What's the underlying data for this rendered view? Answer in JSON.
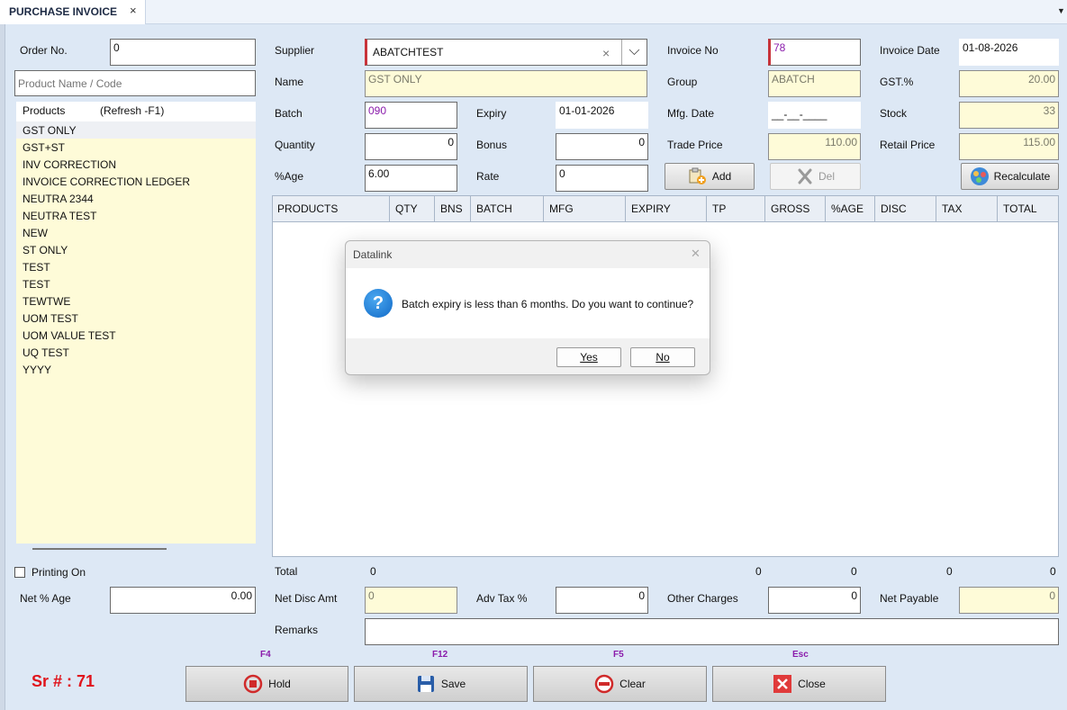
{
  "tab": {
    "title": "PURCHASE INVOICE",
    "close": "×",
    "menu": "▼"
  },
  "order": {
    "label": "Order No.",
    "value": "0"
  },
  "search": {
    "placeholder": "Product Name / Code"
  },
  "products": {
    "header": "Products",
    "refresh": "(Refresh -F1)",
    "items": [
      "GST ONLY",
      "GST+ST",
      "INV CORRECTION",
      "INVOICE CORRECTION LEDGER",
      "NEUTRA 2344",
      "NEUTRA TEST",
      "NEW",
      "ST ONLY",
      "TEST",
      "TEST",
      "TEWTWE",
      "UOM TEST",
      "UOM VALUE TEST",
      "UQ TEST",
      "YYYY"
    ]
  },
  "form": {
    "supplier_label": "Supplier",
    "supplier_value": "ABATCHTEST",
    "supplier_clear": "×",
    "supplier_dropdown": "⌵",
    "name_label": "Name",
    "name_value": "GST ONLY",
    "batch_label": "Batch",
    "batch_value": "090",
    "expiry_label": "Expiry",
    "expiry_value": "01-01-2026",
    "quantity_label": "Quantity",
    "quantity_value": "0",
    "bonus_label": "Bonus",
    "bonus_value": "0",
    "age_label": "%Age",
    "age_value": "6.00",
    "rate_label": "Rate",
    "rate_value": "0",
    "invoice_no_label": "Invoice No",
    "invoice_no_value": "78",
    "group_label": "Group",
    "group_value": "ABATCH",
    "mfg_label": "Mfg. Date",
    "mfg_value": "__-__-____",
    "trade_price_label": "Trade Price",
    "trade_price_value": "110.00",
    "invoice_date_label": "Invoice Date",
    "invoice_date_value": "01-08-2026",
    "gst_label": "GST.%",
    "gst_value": "20.00",
    "stock_label": "Stock",
    "stock_value": "33",
    "retail_price_label": "Retail Price",
    "retail_price_value": "115.00"
  },
  "buttons": {
    "add": "Add",
    "del": "Del",
    "recalculate": "Recalculate"
  },
  "grid": {
    "columns": [
      "PRODUCTS",
      "QTY",
      "BNS",
      "BATCH",
      "MFG",
      "EXPIRY",
      "TP",
      "GROSS",
      "%AGE",
      "DISC",
      "TAX",
      "TOTAL"
    ]
  },
  "totals": {
    "label": "Total",
    "qty": "0",
    "gross": "0",
    "age": "0",
    "tax": "0",
    "total": "0"
  },
  "footer": {
    "printing_label": "Printing On",
    "net_age_label": "Net % Age",
    "net_age_value": "0.00",
    "net_disc_label": "Net Disc Amt",
    "net_disc_value": "0",
    "adv_tax_label": "Adv Tax %",
    "adv_tax_value": "0",
    "other_charges_label": "Other Charges",
    "other_charges_value": "0",
    "net_payable_label": "Net Payable",
    "net_payable_value": "0",
    "remarks_label": "Remarks",
    "remarks_value": ""
  },
  "actions": {
    "hold": {
      "key": "F4",
      "label": "Hold"
    },
    "save": {
      "key": "F12",
      "label": "Save"
    },
    "clear": {
      "key": "F5",
      "label": "Clear"
    },
    "close": {
      "key": "Esc",
      "label": "Close"
    }
  },
  "sr": "Sr # : 71",
  "dialog": {
    "title": "Datalink",
    "close": "✕",
    "icon": "?",
    "message": "Batch expiry is less than 6 months. Do you want to continue?",
    "yes": "Yes",
    "no": "No"
  }
}
